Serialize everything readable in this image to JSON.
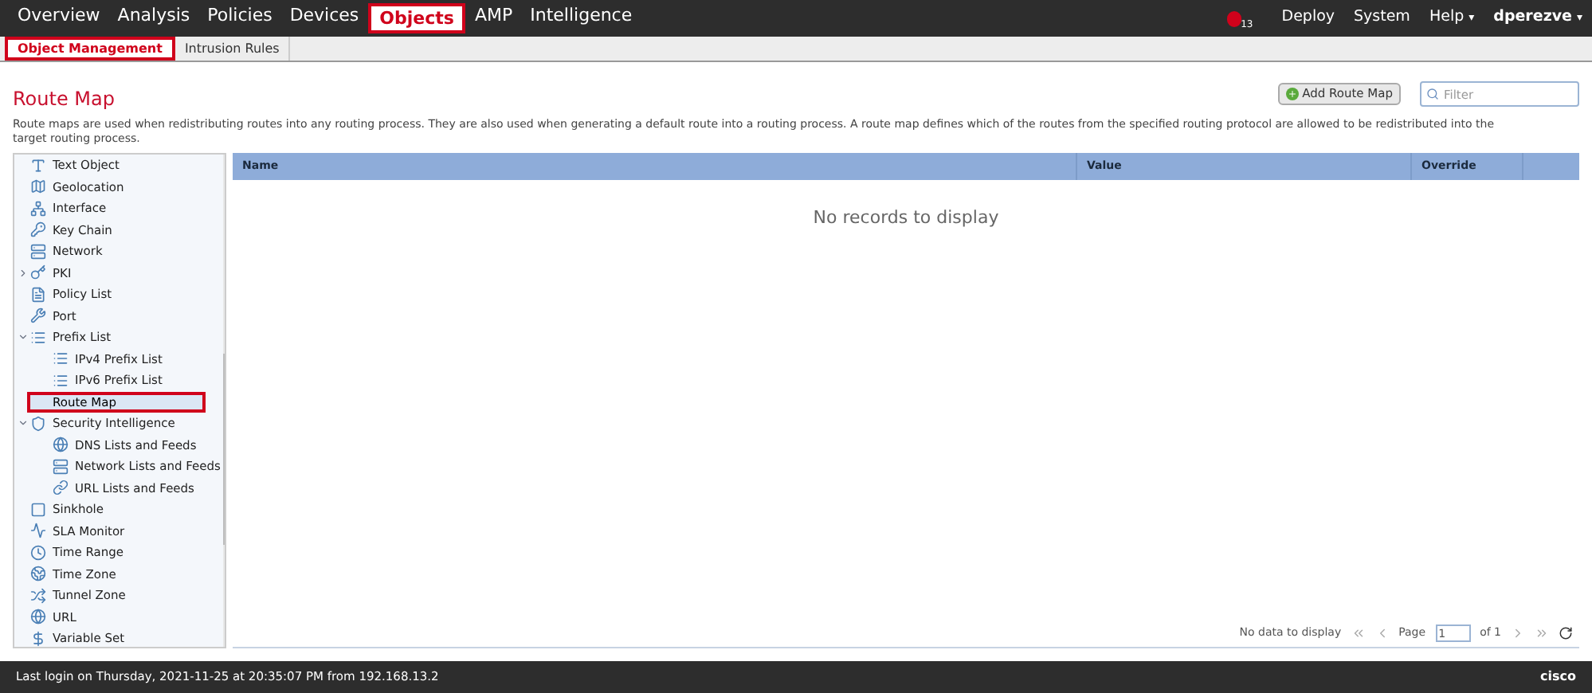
{
  "top_nav": {
    "items": [
      {
        "label": "Overview",
        "selected": false
      },
      {
        "label": "Analysis",
        "selected": false
      },
      {
        "label": "Policies",
        "selected": false
      },
      {
        "label": "Devices",
        "selected": false
      },
      {
        "label": "Objects",
        "selected": true
      },
      {
        "label": "AMP",
        "selected": false
      },
      {
        "label": "Intelligence",
        "selected": false
      }
    ],
    "alert_count": "13",
    "right_items": [
      {
        "label": "Deploy",
        "bold": false
      },
      {
        "label": "System",
        "bold": false
      },
      {
        "label": "Help",
        "caret": "▾",
        "bold": false
      },
      {
        "label": "dperezve",
        "caret": "▾",
        "bold": true
      }
    ]
  },
  "sub_nav": {
    "tabs": [
      {
        "label": "Object Management",
        "selected": true
      },
      {
        "label": "Intrusion Rules",
        "selected": false
      }
    ]
  },
  "page": {
    "title": "Route Map",
    "add_button": "Add Route Map",
    "filter": {
      "placeholder": "Filter"
    },
    "description": "Route maps are used when redistributing routes into any routing process. They are also used when generating a default route into a routing process. A route map defines which of the routes from the specified routing protocol are allowed to be redistributed into the target routing process."
  },
  "sidebar": {
    "items": [
      {
        "label": "Text Object",
        "selected": false
      },
      {
        "label": "Geolocation",
        "selected": false
      },
      {
        "label": "Interface",
        "selected": false
      },
      {
        "label": "Key Chain",
        "selected": false
      },
      {
        "label": "Network",
        "selected": false
      },
      {
        "label": "PKI",
        "selected": false,
        "expanded": false
      },
      {
        "label": "Policy List",
        "selected": false
      },
      {
        "label": "Port",
        "selected": false
      },
      {
        "label": "Prefix List",
        "selected": false,
        "expanded": true,
        "children": [
          {
            "label": "IPv4 Prefix List",
            "selected": false
          },
          {
            "label": "IPv6 Prefix List",
            "selected": false
          }
        ]
      },
      {
        "label": "Route Map",
        "selected": true
      },
      {
        "label": "Security Intelligence",
        "selected": false,
        "expanded": true,
        "children": [
          {
            "label": "DNS Lists and Feeds",
            "selected": false
          },
          {
            "label": "Network Lists and Feeds",
            "selected": false
          },
          {
            "label": "URL Lists and Feeds",
            "selected": false
          }
        ]
      },
      {
        "label": "Sinkhole",
        "selected": false
      },
      {
        "label": "SLA Monitor",
        "selected": false
      },
      {
        "label": "Time Range",
        "selected": false
      },
      {
        "label": "Time Zone",
        "selected": false
      },
      {
        "label": "Tunnel Zone",
        "selected": false
      },
      {
        "label": "URL",
        "selected": false
      },
      {
        "label": "Variable Set",
        "selected": false
      }
    ]
  },
  "table": {
    "columns": [
      "Name",
      "Value",
      "Override"
    ],
    "empty_message": "No records to display"
  },
  "pager": {
    "status": "No data to display",
    "page_label": "Page",
    "page": "1",
    "of_label": "of 1"
  },
  "status_bar": {
    "last_login": "Last login on Thursday, 2021-11-25 at 20:35:07 PM from 192.168.13.2",
    "logo": "cisco"
  }
}
